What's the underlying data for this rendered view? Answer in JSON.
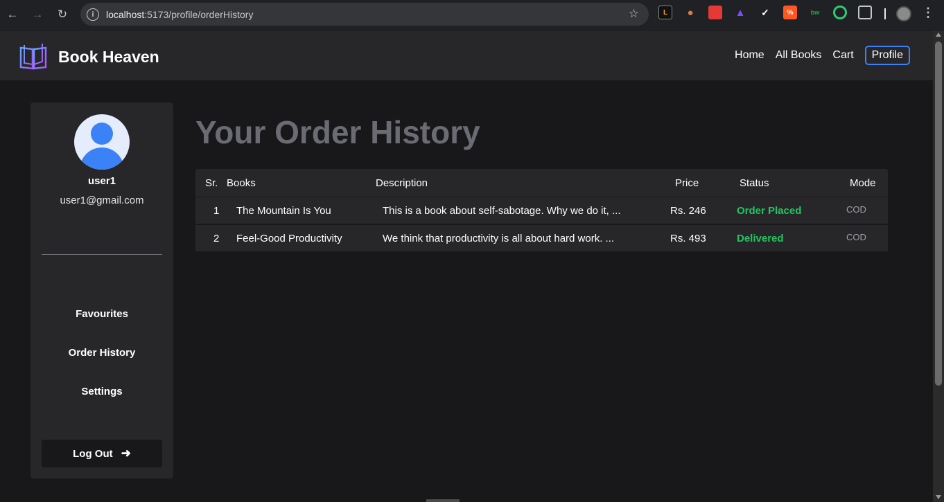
{
  "browser": {
    "url_host": "localhost",
    "url_path": ":5173/profile/orderHistory"
  },
  "header": {
    "brand": "Book Heaven",
    "nav": [
      "Home",
      "All Books",
      "Cart"
    ],
    "profile_label": "Profile"
  },
  "sidebar": {
    "username": "user1",
    "email": "user1@gmail.com",
    "links": [
      "Favourites",
      "Order History",
      "Settings"
    ],
    "logout_label": "Log Out"
  },
  "main": {
    "title": "Your Order History",
    "columns": [
      "Sr.",
      "Books",
      "Description",
      "Price",
      "Status",
      "Mode"
    ],
    "orders": [
      {
        "sr": "1",
        "book": "The Mountain Is You",
        "description": "This is a book about self-sabotage. Why we do it, ...",
        "price": "Rs. 246",
        "status": "Order Placed",
        "mode": "COD"
      },
      {
        "sr": "2",
        "book": "Feel-Good Productivity",
        "description": "We think that productivity is all about hard work. ...",
        "price": "Rs. 493",
        "status": "Delivered",
        "mode": "COD"
      }
    ]
  },
  "colors": {
    "accent": "#3b82f6",
    "status_green": "#22c55e",
    "background": "#18181b",
    "panel": "#27272a"
  }
}
